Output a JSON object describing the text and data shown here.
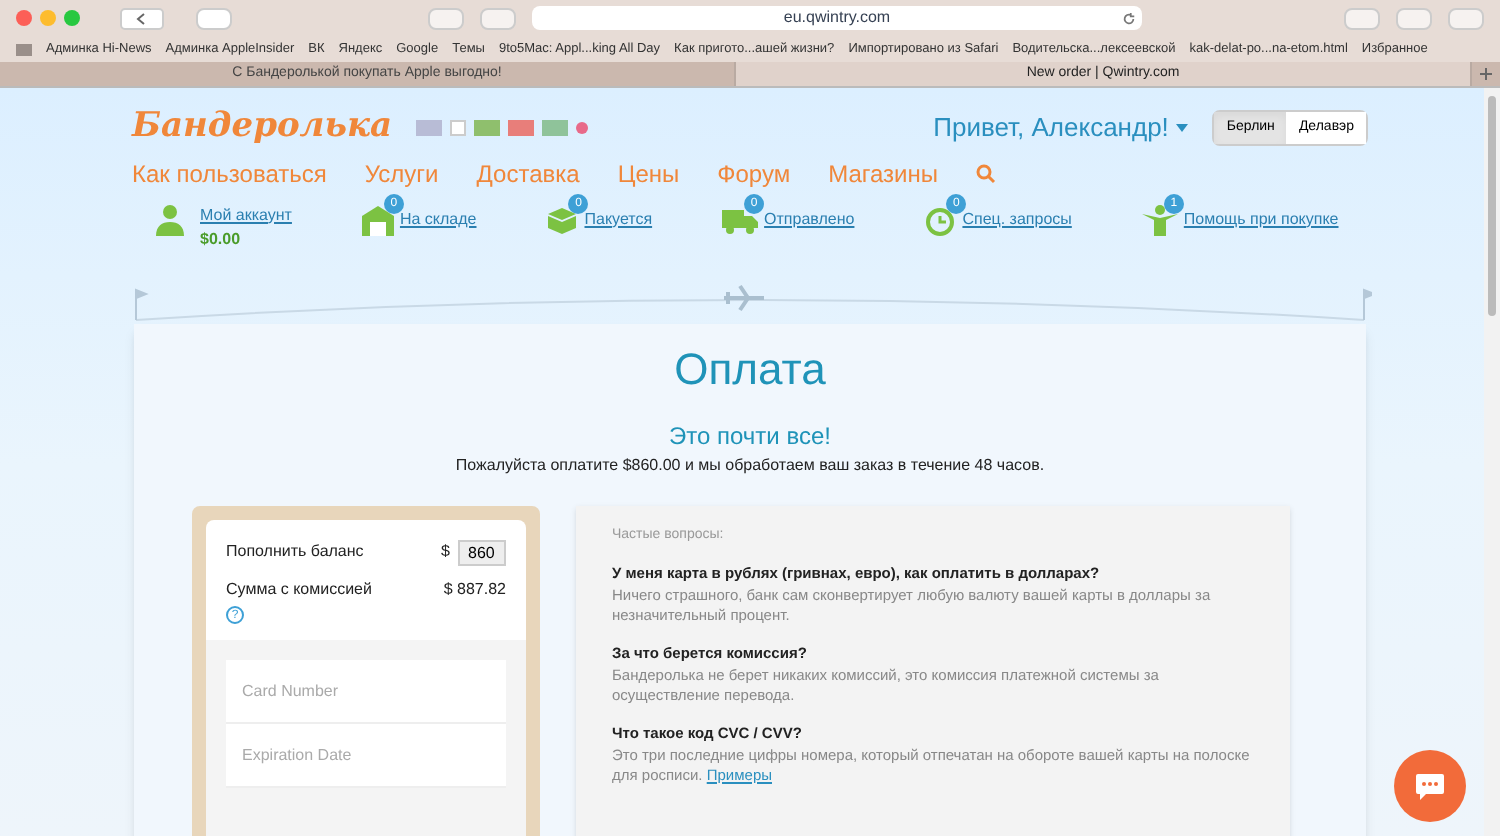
{
  "browser": {
    "address": "eu.qwintry.com",
    "bookmarks": [
      "Админка Hi-News",
      "Админка AppleInsider",
      "ВК",
      "Яндекс",
      "Google",
      "Темы",
      "9to5Mac: Appl...king All Day",
      "Как пригото...ашей жизни?",
      "Импортировано из Safari",
      "Водительска...лексеевской",
      "kak-delat-po...na-etom.html",
      "Избранное"
    ],
    "tabs": [
      {
        "title": "С Бандеролькой покупать Apple выгодно!",
        "selected": false
      },
      {
        "title": "New order | Qwintry.com",
        "selected": true
      }
    ]
  },
  "header": {
    "logo": "Бандеролька",
    "greeting": "Привет, Александр!",
    "cities": [
      {
        "label": "Берлин",
        "selected": true
      },
      {
        "label": "Делавэр",
        "selected": false
      }
    ],
    "nav": [
      "Как пользоваться",
      "Услуги",
      "Доставка",
      "Цены",
      "Форум",
      "Магазины"
    ],
    "account": {
      "label": "Мой аккаунт",
      "balance": "$0.00"
    },
    "status": [
      {
        "label": "На складе",
        "count": "0",
        "kind": "warehouse"
      },
      {
        "label": "Пакуется",
        "count": "0",
        "kind": "boxes"
      },
      {
        "label": "Отправлено",
        "count": "0",
        "kind": "truck"
      },
      {
        "label": "Спец. запросы",
        "count": "0",
        "kind": "clock"
      },
      {
        "label": "Помощь при покупке",
        "count": "1",
        "kind": "person"
      }
    ]
  },
  "main": {
    "title": "Оплата",
    "subtitle": "Это почти все!",
    "message": "Пожалуйста оплатите $860.00 и мы обработаем ваш заказ в течение 48 часов.",
    "payment": {
      "topup_label": "Пополнить баланс",
      "currency": "$",
      "amount": "860",
      "fee_label": "Сумма с комиссией",
      "fee": "$ 887.82",
      "help": "?",
      "card_fields": [
        {
          "placeholder": "Card Number"
        },
        {
          "placeholder": "Expiration Date"
        }
      ]
    },
    "faq": {
      "heading": "Частые вопросы:",
      "items": [
        {
          "question": "У меня карта в рублях (гривнах, евро), как оплатить в долларах?",
          "answer": "Ничего страшного, банк сам сконвертирует любую валюту вашей карты в доллары за незначительный процент."
        },
        {
          "question": "За что берется комиссия?",
          "answer": "Бандеролька не берет никаких комиссий, это комиссия платежной системы за осуществление перевода."
        },
        {
          "question": "Что такое код CVC / CVV?",
          "answer": "Это три последние цифры номера, который отпечатан на обороте вашей карты на полоске для росписи.",
          "link": "Примеры"
        }
      ]
    }
  }
}
